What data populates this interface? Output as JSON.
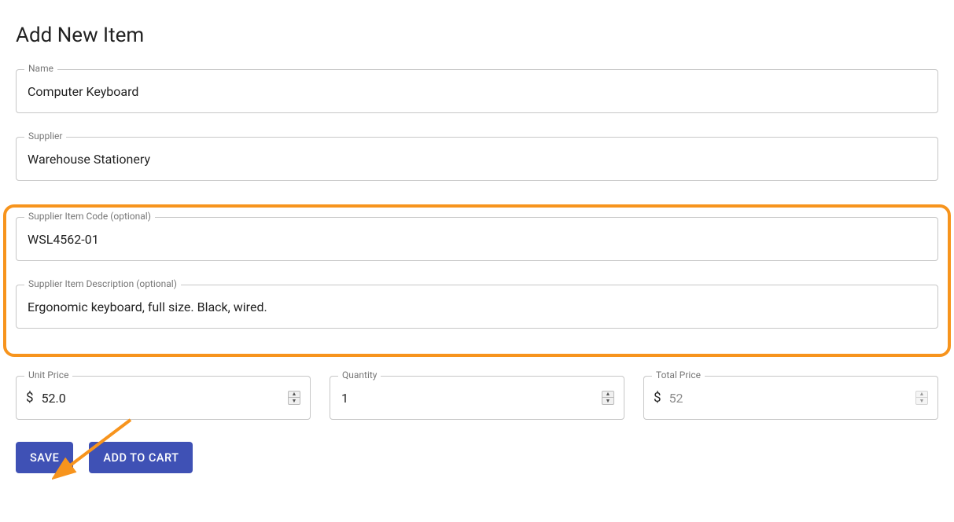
{
  "title": "Add New Item",
  "fields": {
    "name": {
      "label": "Name",
      "value": "Computer Keyboard"
    },
    "supplier": {
      "label": "Supplier",
      "value": "Warehouse Stationery"
    },
    "supplier_item_code": {
      "label": "Supplier Item Code (optional)",
      "value": "WSL4562-01"
    },
    "supplier_item_desc": {
      "label": "Supplier Item Description (optional)",
      "value": "Ergonomic keyboard, full size. Black, wired."
    },
    "unit_price": {
      "label": "Unit Price",
      "value": "52.0",
      "prefix": "$"
    },
    "quantity": {
      "label": "Quantity",
      "value": "1"
    },
    "total_price": {
      "label": "Total Price",
      "value": "52",
      "prefix": "$"
    }
  },
  "buttons": {
    "save": "SAVE",
    "add_to_cart": "ADD TO CART"
  }
}
